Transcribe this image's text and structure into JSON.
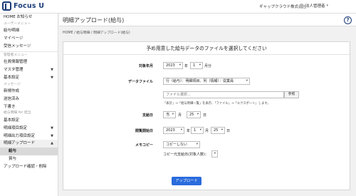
{
  "header": {
    "logo_text": "Focus U",
    "company": "ギャップクラウド株式会社",
    "user": "法人管理者"
  },
  "sidebar": {
    "home": "HOME お知らせ",
    "user_menu_section": "ユーザーメニュー",
    "payslip": "給与明細",
    "mypage": "マイページ",
    "send_message": "受信メッセージ",
    "admin_menu_section": "管理者メニュー",
    "employee_mgmt": "社員情報管理",
    "master_mgmt": "マスタ管理",
    "basic_settings": "基本設定",
    "message_section": "メッセージ",
    "new_create": "新規作成",
    "sent": "送信済み",
    "draft": "下書き",
    "payslip_mgmt_section": "給与明細 for 担当",
    "basic_settings2": "基本設定",
    "detail_item_setting": "明細項目設定",
    "detail_output_setting": "明細出力項目設定",
    "detail_upload": "明細アップロード",
    "salary": "給与",
    "bonus": "賞与",
    "upload_confirm": "アップロード確認・削除"
  },
  "main": {
    "page_title": "明細アップロード(給与)",
    "breadcrumb": "HOME / 給与明細 / 明細アップロード(給与)",
    "card_title": "予め用意した給与データのファイルを選択してください"
  },
  "form": {
    "target_month_label": "対象年月",
    "year_value": "2023",
    "year_unit": "年",
    "month_value": "1",
    "month_unit": "月分",
    "data_file_label": "データファイル",
    "layout_option": "行（給与）：明細項目、列（情報）：従業員",
    "file_placeholder": "ファイル選択...",
    "browse_label": "参照",
    "file_note": "「表計」→「給与明細一覧」を表示、「ファイル」→「エクスポート」します。",
    "payday_label": "支給日",
    "payday_month_prefix": "当",
    "payday_month_unit": "月",
    "payday_day": "25",
    "payday_day_unit": "日",
    "publish_label": "閲覧開始日",
    "publish_year": "2023",
    "publish_year_unit": "年",
    "publish_month": "1",
    "publish_month_unit": "月",
    "publish_day": "25",
    "publish_day_unit": "日",
    "memo_copy_label": "メモコピー",
    "memo_copy_value": "コピーしない",
    "copy_source_label": "コピー元支給日(対象人数)：",
    "upload_button": "アップロード"
  }
}
